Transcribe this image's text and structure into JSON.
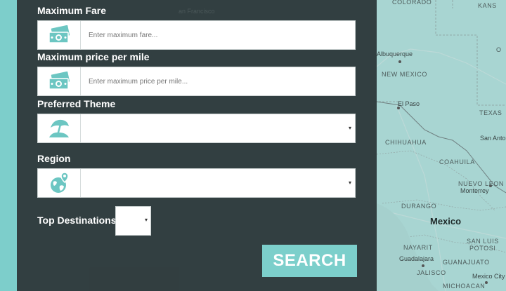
{
  "form": {
    "max_fare": {
      "label": "Maximum Fare",
      "placeholder": "Enter maximum fare..."
    },
    "max_price_per_mile": {
      "label": "Maximum price per mile",
      "placeholder": "Enter maximum price per mile..."
    },
    "preferred_theme": {
      "label": "Preferred Theme",
      "value": ""
    },
    "region": {
      "label": "Region",
      "value": ""
    },
    "top_destinations": {
      "label": "Top Destinations",
      "value": ""
    },
    "search_label": "SEARCH",
    "caret": "▾"
  },
  "map": {
    "labels": {
      "colorado": "COLORADO",
      "kansas": "KANS",
      "albuquerque": "Albuquerque",
      "new_mexico": "NEW MEXICO",
      "el_paso": "El Paso",
      "texas": "TEXAS",
      "san_antonio": "San Anto",
      "chihuahua": "CHIHUAHUA",
      "coahuila": "COAHUILA",
      "nuevo_leon": "NUEVO LEON",
      "monterrey": "Monterrey",
      "durango": "DURANGO",
      "mexico": "Mexico",
      "nayarit": "NAYARIT",
      "san_luis_potosi_1": "SAN LUIS",
      "san_luis_potosi_2": "POTOSI",
      "guadalajara": "Guadalajara",
      "guanajuato": "GUANAJUATO",
      "jalisco": "JALISCO",
      "mexico_city": "Mexico City",
      "michoacan": "MICHOACAN",
      "san_francisco": "an Francisco",
      "ok_partial": "O"
    }
  },
  "colors": {
    "panel": "#2d383a",
    "accent": "#7ccfcb",
    "icon": "#6cc6c2"
  }
}
